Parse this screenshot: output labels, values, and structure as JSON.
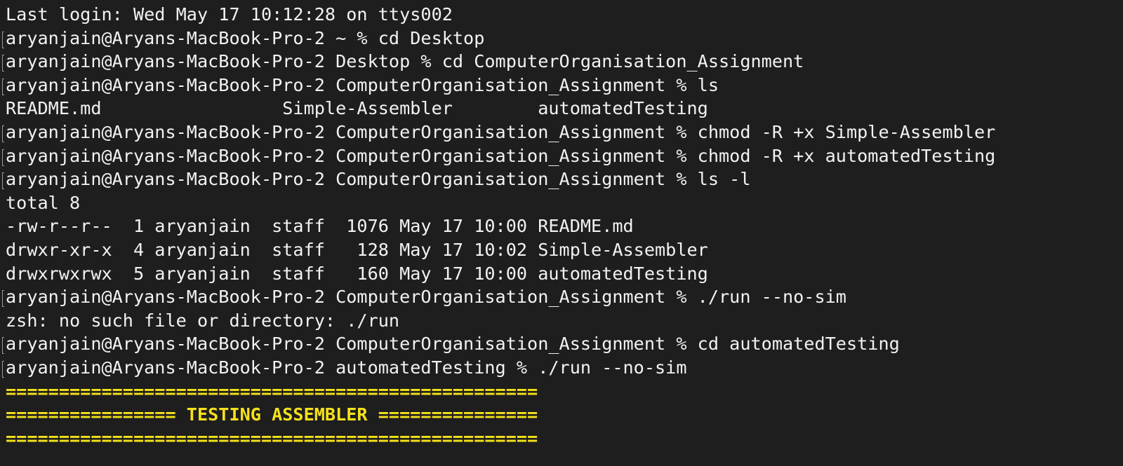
{
  "terminal": {
    "lines": [
      {
        "text": "Last login: Wed May 17 10:12:28 on ttys002"
      },
      {
        "text": "aryanjain@Aryans-MacBook-Pro-2 ~ % cd Desktop"
      },
      {
        "text": "aryanjain@Aryans-MacBook-Pro-2 Desktop % cd ComputerOrganisation_Assignment"
      },
      {
        "text": "aryanjain@Aryans-MacBook-Pro-2 ComputerOrganisation_Assignment % ls"
      },
      {
        "text": "README.md                 Simple-Assembler        automatedTesting"
      },
      {
        "text": "aryanjain@Aryans-MacBook-Pro-2 ComputerOrganisation_Assignment % chmod -R +x Simple-Assembler"
      },
      {
        "text": "aryanjain@Aryans-MacBook-Pro-2 ComputerOrganisation_Assignment % chmod -R +x automatedTesting"
      },
      {
        "text": "aryanjain@Aryans-MacBook-Pro-2 ComputerOrganisation_Assignment % ls -l"
      },
      {
        "text": "total 8"
      },
      {
        "text": "-rw-r--r--  1 aryanjain  staff  1076 May 17 10:00 README.md"
      },
      {
        "text": "drwxr-xr-x  4 aryanjain  staff   128 May 17 10:02 Simple-Assembler"
      },
      {
        "text": "drwxrwxrwx  5 aryanjain  staff   160 May 17 10:00 automatedTesting"
      },
      {
        "text": "aryanjain@Aryans-MacBook-Pro-2 ComputerOrganisation_Assignment % ./run --no-sim"
      },
      {
        "text": "zsh: no such file or directory: ./run"
      },
      {
        "text": "aryanjain@Aryans-MacBook-Pro-2 ComputerOrganisation_Assignment % cd automatedTesting"
      },
      {
        "text": "aryanjain@Aryans-MacBook-Pro-2 automatedTesting % ./run --no-sim"
      },
      {
        "text": "=================================================="
      },
      {
        "text": "================ TESTING ASSEMBLER ==============="
      },
      {
        "text": "=================================================="
      }
    ],
    "colors": {
      "background": "#1e1e1e",
      "foreground": "#f2f2f2",
      "banner": "#f5e11c"
    }
  }
}
